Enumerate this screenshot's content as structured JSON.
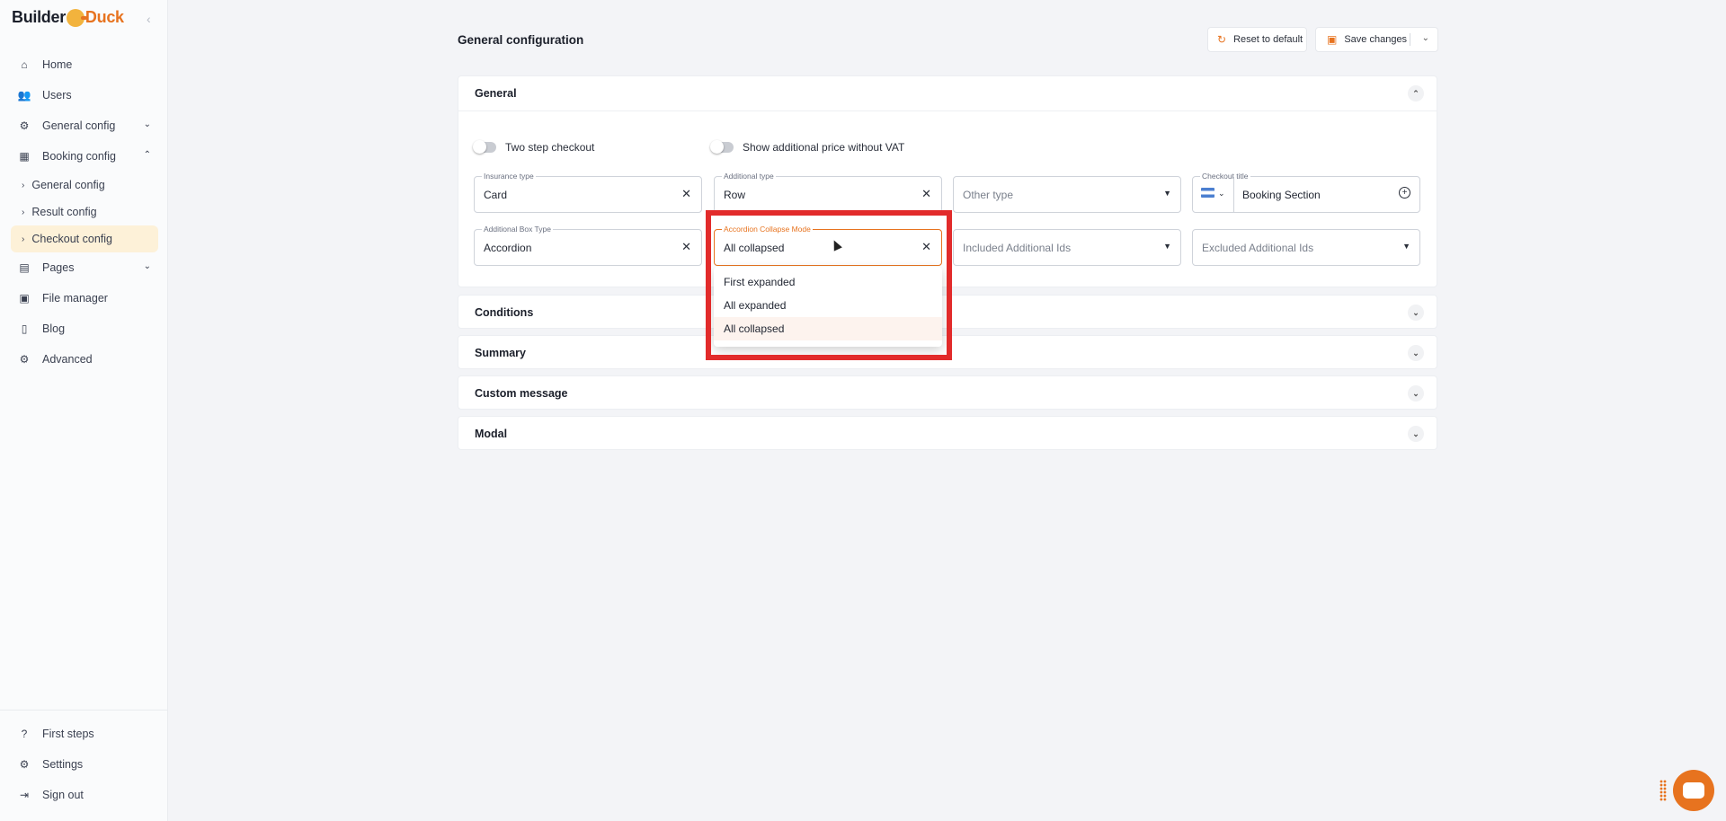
{
  "brand": {
    "part1": "Builder",
    "part2": "Duck"
  },
  "sidebar": {
    "items": [
      {
        "label": "Home",
        "icon": "home-icon"
      },
      {
        "label": "Users",
        "icon": "users-icon"
      },
      {
        "label": "General config",
        "icon": "gear-icon"
      },
      {
        "label": "Booking config",
        "icon": "calendar-icon"
      },
      {
        "label": "General config"
      },
      {
        "label": "Result config"
      },
      {
        "label": "Checkout config"
      },
      {
        "label": "Pages",
        "icon": "pages-icon"
      },
      {
        "label": "File manager",
        "icon": "folder-icon"
      },
      {
        "label": "Blog",
        "icon": "document-icon"
      },
      {
        "label": "Advanced",
        "icon": "advanced-gear-icon"
      }
    ],
    "bottom": [
      {
        "label": "First steps",
        "icon": "help-icon"
      },
      {
        "label": "Settings",
        "icon": "settings-icon"
      },
      {
        "label": "Sign out",
        "icon": "sign-out-icon"
      }
    ]
  },
  "header": {
    "title": "General configuration",
    "reset_label": "Reset to default",
    "save_label": "Save changes"
  },
  "general": {
    "title": "General",
    "toggles": [
      "Two step checkout",
      "Show additional price without VAT"
    ],
    "fields": {
      "insurance_type": {
        "label": "Insurance type",
        "value": "Card"
      },
      "additional_type": {
        "label": "Additional type",
        "value": "Row"
      },
      "other_type": {
        "placeholder": "Other type"
      },
      "checkout_title": {
        "label": "Checkout title",
        "value": "Booking Section"
      },
      "additional_box_type": {
        "label": "Additional Box Type",
        "value": "Accordion"
      },
      "accordion_collapse_mode": {
        "label": "Accordion Collapse Mode",
        "value": "All collapsed"
      },
      "included_ids": {
        "placeholder": "Included Additional Ids"
      },
      "excluded_ids": {
        "placeholder": "Excluded Additional Ids"
      }
    },
    "dropdown_options": [
      "First expanded",
      "All expanded",
      "All collapsed"
    ]
  },
  "sections": [
    "Conditions",
    "Summary",
    "Custom message",
    "Modal"
  ],
  "colors": {
    "accent": "#e7731f",
    "highlight": "#e22b2b"
  }
}
